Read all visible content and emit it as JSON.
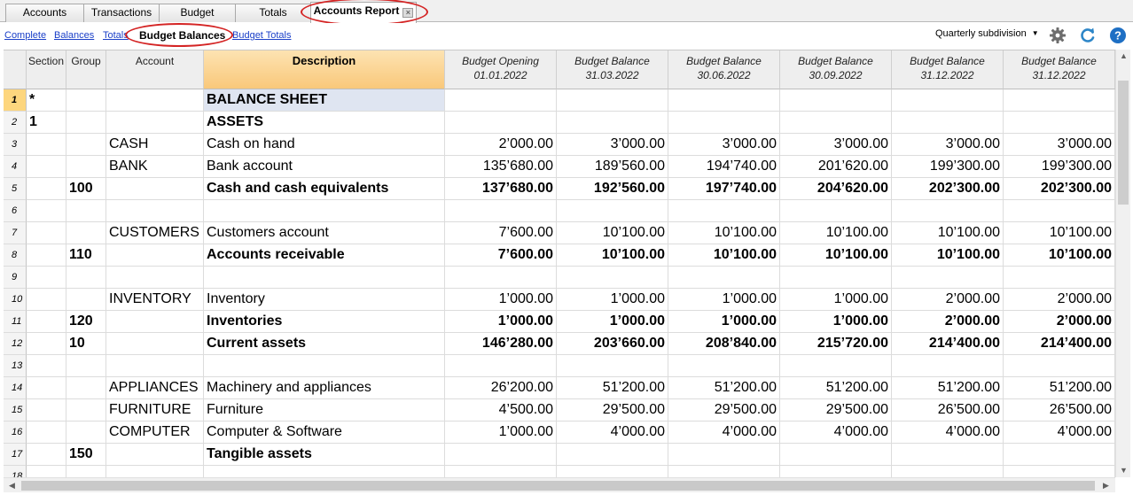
{
  "tabs": [
    {
      "label": "Accounts"
    },
    {
      "label": "Transactions"
    },
    {
      "label": "Budget"
    },
    {
      "label": "Totals"
    },
    {
      "label": "Accounts Report",
      "active": true
    }
  ],
  "views": [
    {
      "label": "Complete"
    },
    {
      "label": "Balances"
    },
    {
      "label": "Totals"
    },
    {
      "label": "Budget Balances",
      "active": true
    },
    {
      "label": "Budget Totals"
    }
  ],
  "toolbar": {
    "subdivision": "Quarterly subdivision",
    "icons": [
      "gear-icon",
      "refresh-icon",
      "help-icon"
    ]
  },
  "columns": {
    "rownum": "",
    "section": "Section",
    "group": "Group",
    "account": "Account",
    "description": "Description",
    "amounts": [
      {
        "title": "Budget Opening",
        "date": "01.01.2022"
      },
      {
        "title": "Budget Balance",
        "date": "31.03.2022"
      },
      {
        "title": "Budget Balance",
        "date": "30.06.2022"
      },
      {
        "title": "Budget Balance",
        "date": "30.09.2022"
      },
      {
        "title": "Budget Balance",
        "date": "31.12.2022"
      },
      {
        "title": "Budget Balance",
        "date": "31.12.2022"
      }
    ]
  },
  "rows": [
    {
      "n": "1",
      "section": "*",
      "group": "",
      "account": "",
      "description": "BALANCE SHEET",
      "amounts": [
        "",
        "",
        "",
        "",
        "",
        ""
      ],
      "bold": true
    },
    {
      "n": "2",
      "section": "1",
      "group": "",
      "account": "",
      "description": "ASSETS",
      "amounts": [
        "",
        "",
        "",
        "",
        "",
        ""
      ],
      "bold": true
    },
    {
      "n": "3",
      "section": "",
      "group": "",
      "account": "CASH",
      "description": "Cash on hand",
      "amounts": [
        "2’000.00",
        "3’000.00",
        "3’000.00",
        "3’000.00",
        "3’000.00",
        "3’000.00"
      ],
      "bold": false
    },
    {
      "n": "4",
      "section": "",
      "group": "",
      "account": "BANK",
      "description": "Bank account",
      "amounts": [
        "135’680.00",
        "189’560.00",
        "194’740.00",
        "201’620.00",
        "199’300.00",
        "199’300.00"
      ],
      "bold": false
    },
    {
      "n": "5",
      "section": "",
      "group": "100",
      "account": "",
      "description": "Cash and cash equivalents",
      "amounts": [
        "137’680.00",
        "192’560.00",
        "197’740.00",
        "204’620.00",
        "202’300.00",
        "202’300.00"
      ],
      "bold": true
    },
    {
      "n": "6",
      "section": "",
      "group": "",
      "account": "",
      "description": "",
      "amounts": [
        "",
        "",
        "",
        "",
        "",
        ""
      ],
      "bold": false
    },
    {
      "n": "7",
      "section": "",
      "group": "",
      "account": "CUSTOMERS",
      "description": "Customers account",
      "amounts": [
        "7’600.00",
        "10’100.00",
        "10’100.00",
        "10’100.00",
        "10’100.00",
        "10’100.00"
      ],
      "bold": false
    },
    {
      "n": "8",
      "section": "",
      "group": "110",
      "account": "",
      "description": "Accounts receivable",
      "amounts": [
        "7’600.00",
        "10’100.00",
        "10’100.00",
        "10’100.00",
        "10’100.00",
        "10’100.00"
      ],
      "bold": true
    },
    {
      "n": "9",
      "section": "",
      "group": "",
      "account": "",
      "description": "",
      "amounts": [
        "",
        "",
        "",
        "",
        "",
        ""
      ],
      "bold": false
    },
    {
      "n": "10",
      "section": "",
      "group": "",
      "account": "INVENTORY",
      "description": "Inventory",
      "amounts": [
        "1’000.00",
        "1’000.00",
        "1’000.00",
        "1’000.00",
        "2’000.00",
        "2’000.00"
      ],
      "bold": false
    },
    {
      "n": "11",
      "section": "",
      "group": "120",
      "account": "",
      "description": "Inventories",
      "amounts": [
        "1’000.00",
        "1’000.00",
        "1’000.00",
        "1’000.00",
        "2’000.00",
        "2’000.00"
      ],
      "bold": true
    },
    {
      "n": "12",
      "section": "",
      "group": "10",
      "account": "",
      "description": "Current assets",
      "amounts": [
        "146’280.00",
        "203’660.00",
        "208’840.00",
        "215’720.00",
        "214’400.00",
        "214’400.00"
      ],
      "bold": true
    },
    {
      "n": "13",
      "section": "",
      "group": "",
      "account": "",
      "description": "",
      "amounts": [
        "",
        "",
        "",
        "",
        "",
        ""
      ],
      "bold": false
    },
    {
      "n": "14",
      "section": "",
      "group": "",
      "account": "APPLIANCES",
      "description": "Machinery and appliances",
      "amounts": [
        "26’200.00",
        "51’200.00",
        "51’200.00",
        "51’200.00",
        "51’200.00",
        "51’200.00"
      ],
      "bold": false
    },
    {
      "n": "15",
      "section": "",
      "group": "",
      "account": "FURNITURE",
      "description": "Furniture",
      "amounts": [
        "4’500.00",
        "29’500.00",
        "29’500.00",
        "29’500.00",
        "26’500.00",
        "26’500.00"
      ],
      "bold": false
    },
    {
      "n": "16",
      "section": "",
      "group": "",
      "account": "COMPUTER",
      "description": "Computer & Software",
      "amounts": [
        "1’000.00",
        "4’000.00",
        "4’000.00",
        "4’000.00",
        "4’000.00",
        "4’000.00"
      ],
      "bold": false
    },
    {
      "n": "17",
      "section": "",
      "group": "150",
      "account": "",
      "description": "Tangible assets",
      "amounts": [
        "",
        "",
        "",
        "",
        "",
        ""
      ],
      "bold": true
    },
    {
      "n": "18",
      "section": "",
      "group": "",
      "account": "",
      "description": "",
      "amounts": [
        "",
        "",
        "",
        "",
        "",
        ""
      ],
      "bold": false
    }
  ],
  "colors": {
    "accent_oval": "#d42424",
    "link": "#1a3fc8",
    "description_header": "#f9c87a",
    "selected_row": "#fdd67e"
  }
}
